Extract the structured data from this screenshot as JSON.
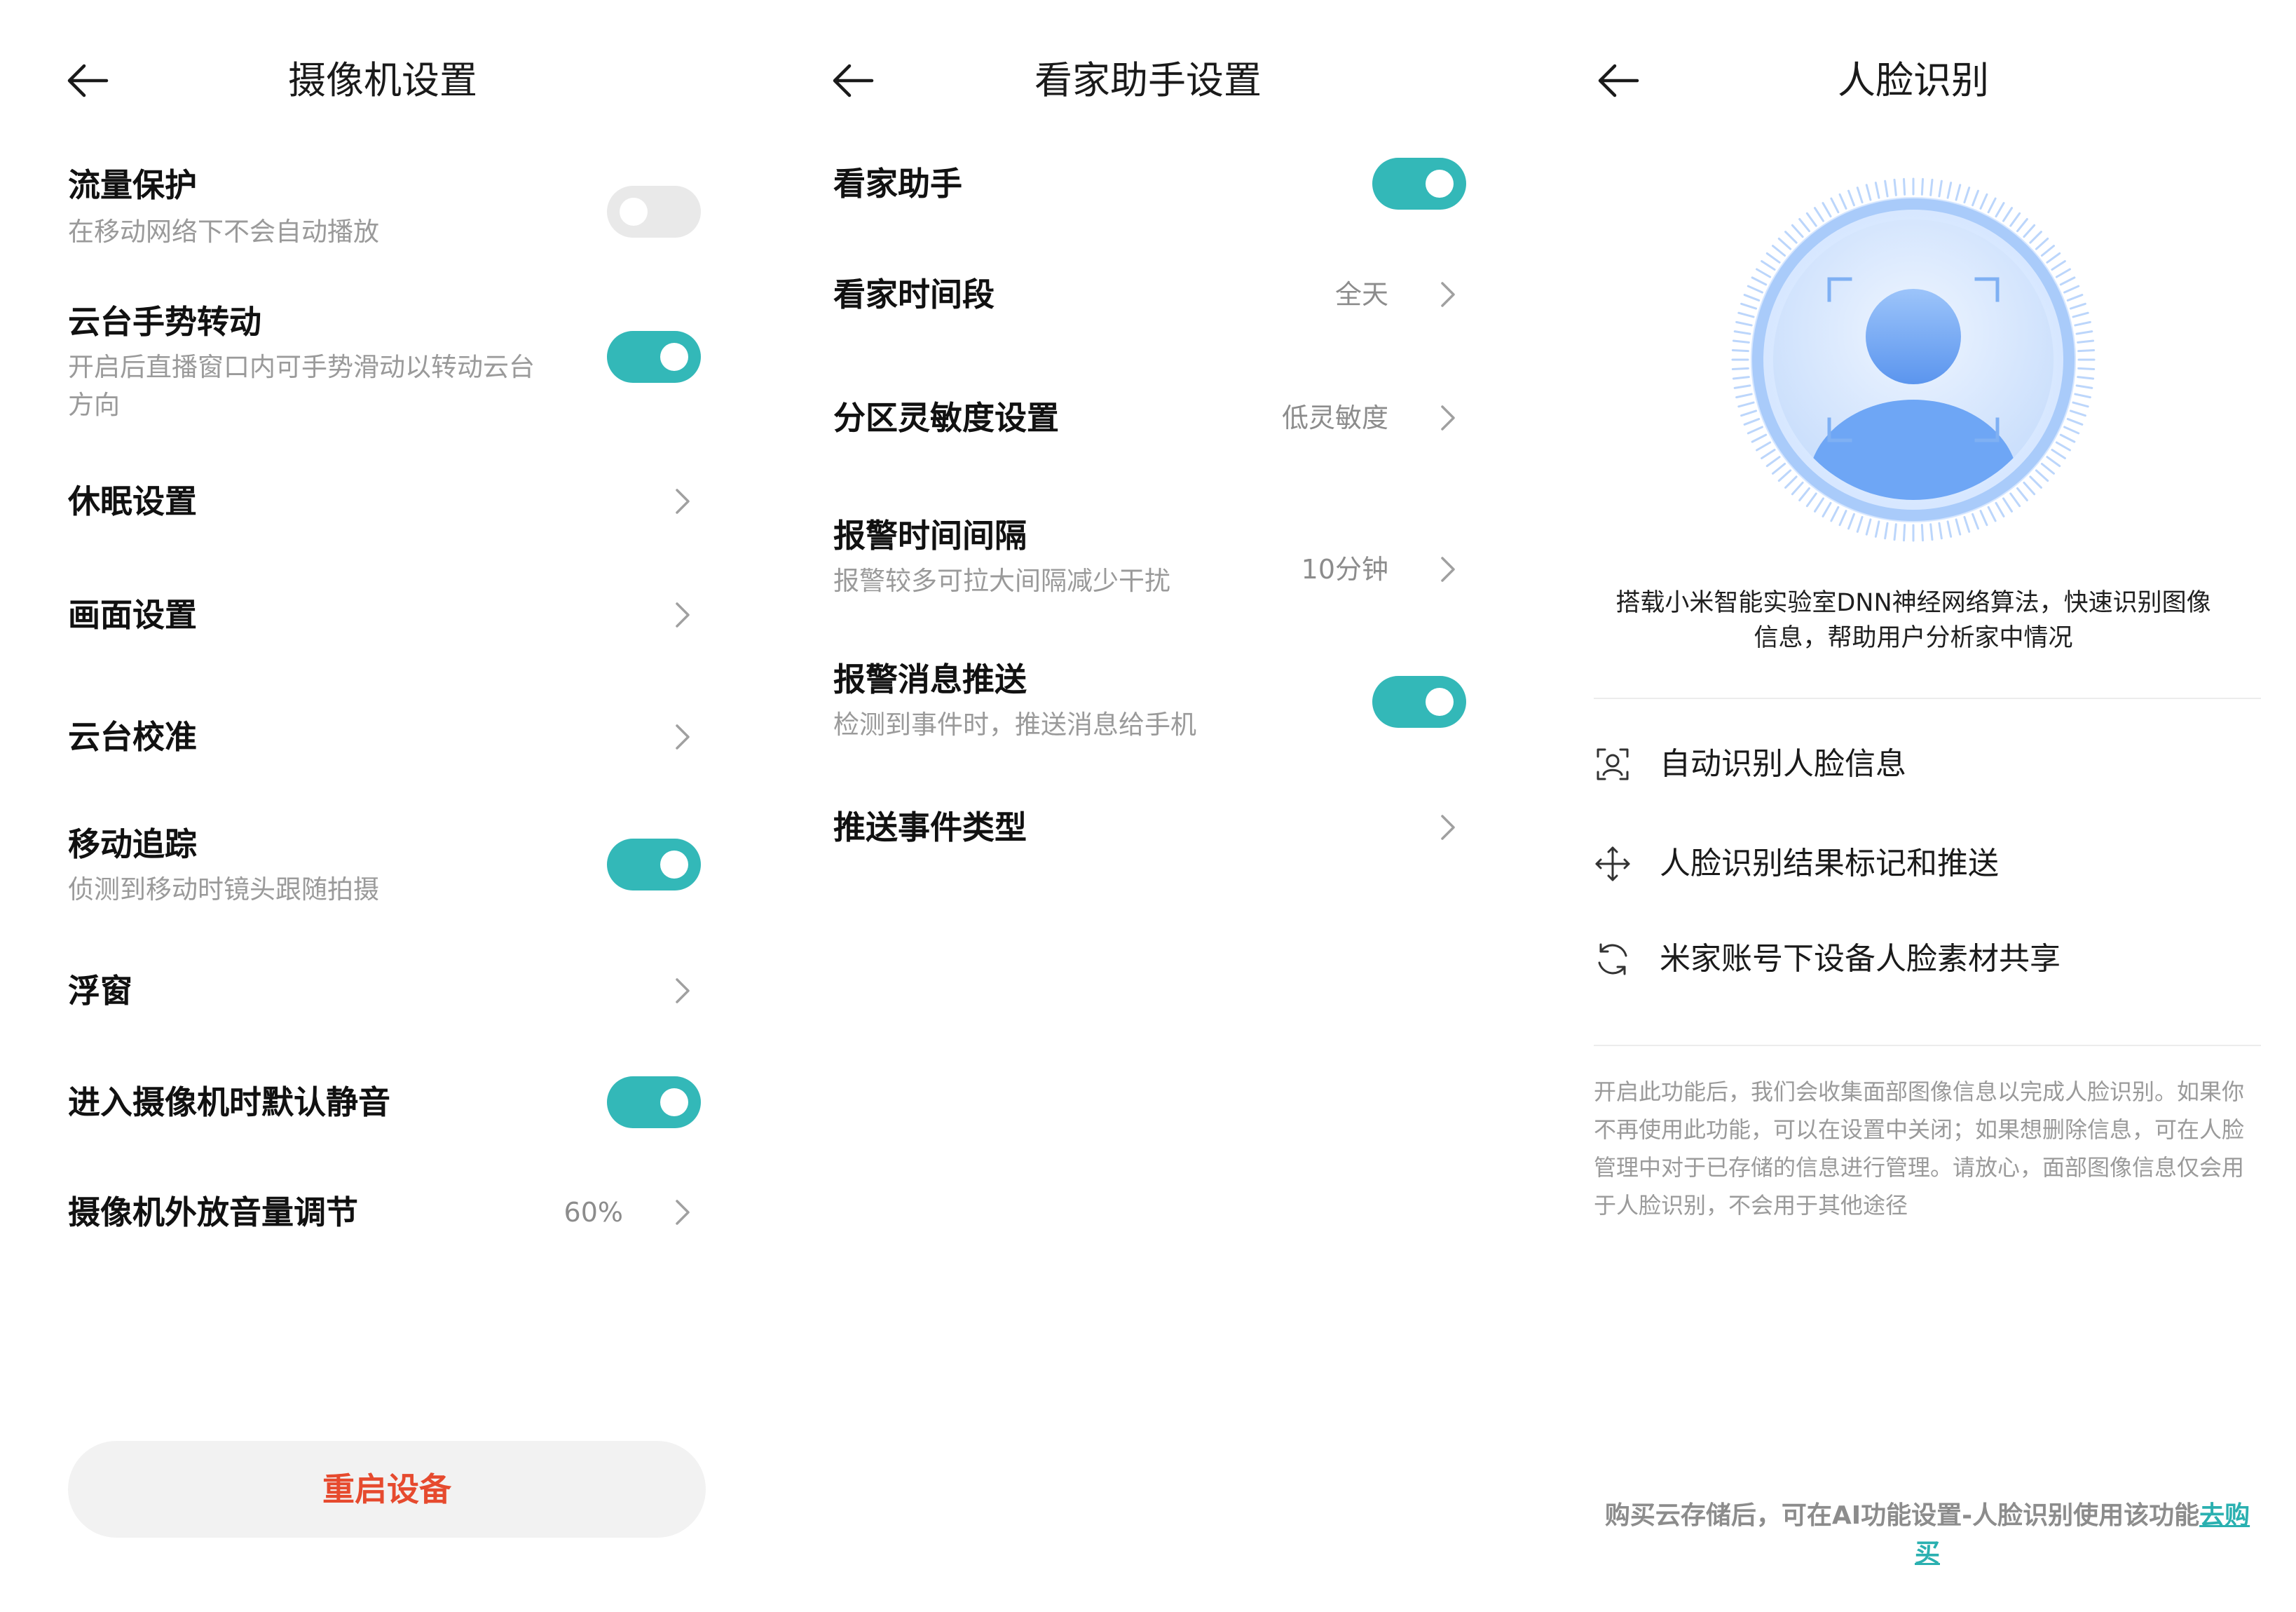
{
  "colors": {
    "accent": "#33b8b8",
    "danger": "#e64a2e",
    "toggle_off": "#e9e9e9",
    "face_blue": "#6ea6f5"
  },
  "screen1": {
    "title": "摄像机设置",
    "rows": [
      {
        "label": "流量保护",
        "sub": "在移动网络下不会自动播放",
        "control": "toggle",
        "on": false
      },
      {
        "label": "云台手势转动",
        "sub": "开启后直播窗口内可手势滑动以转动云台方向",
        "control": "toggle",
        "on": true
      },
      {
        "label": "休眠设置",
        "control": "chevron"
      },
      {
        "label": "画面设置",
        "control": "chevron"
      },
      {
        "label": "云台校准",
        "control": "chevron"
      },
      {
        "label": "移动追踪",
        "sub": "侦测到移动时镜头跟随拍摄",
        "control": "toggle",
        "on": true
      },
      {
        "label": "浮窗",
        "control": "chevron"
      },
      {
        "label": "进入摄像机时默认静音",
        "control": "toggle",
        "on": true
      },
      {
        "label": "摄像机外放音量调节",
        "value": "60%",
        "control": "chevron"
      }
    ],
    "restart_label": "重启设备"
  },
  "screen2": {
    "title": "看家助手设置",
    "rows": [
      {
        "label": "看家助手",
        "control": "toggle",
        "on": true
      },
      {
        "label": "看家时间段",
        "value": "全天",
        "control": "chevron"
      },
      {
        "label": "分区灵敏度设置",
        "value": "低灵敏度",
        "control": "chevron"
      },
      {
        "label": "报警时间间隔",
        "sub": "报警较多可拉大间隔减少干扰",
        "value": "10分钟",
        "control": "chevron"
      },
      {
        "label": "报警消息推送",
        "sub": "检测到事件时，推送消息给手机",
        "control": "toggle",
        "on": true
      },
      {
        "label": "推送事件类型",
        "control": "chevron"
      }
    ]
  },
  "screen3": {
    "title": "人脸识别",
    "description": "搭载小米智能实验室DNN神经网络算法，快速识别图像信息，帮助用户分析家中情况",
    "features": [
      {
        "icon": "face-scan-icon",
        "label": "自动识别人脸信息"
      },
      {
        "icon": "move-arrows-icon",
        "label": "人脸识别结果标记和推送"
      },
      {
        "icon": "sync-icon",
        "label": "米家账号下设备人脸素材共享"
      }
    ],
    "privacy": "开启此功能后，我们会收集面部图像信息以完成人脸识别。如果你不再使用此功能，可以在设置中关闭；如果想删除信息，可在人脸管理中对于已存储的信息进行管理。请放心，面部图像信息仅会用于人脸识别，不会用于其他途径",
    "buy_text": "购买云存储后，可在AI功能设置-人脸识别使用该功能",
    "buy_link": "去购买"
  }
}
